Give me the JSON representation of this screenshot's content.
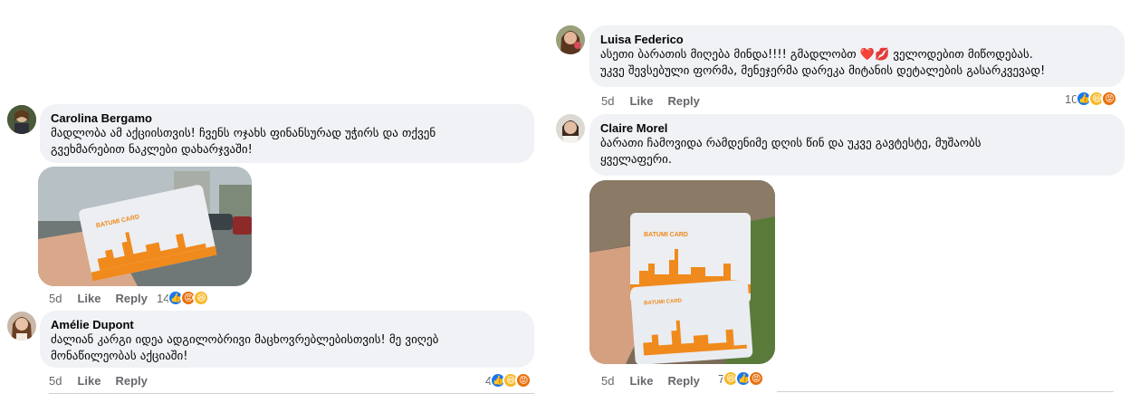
{
  "comments": {
    "carolina": {
      "name": "Carolina Bergamo",
      "lines": [
        "მადლობა ამ აქციისთვის! ჩვენს ოჯახს ფინანსურად უჭირს და თქვენ",
        "გვეხმარებით ნაკლები დახარჯვაში!"
      ],
      "time": "5d",
      "like": "Like",
      "reply": "Reply",
      "reactions": "14"
    },
    "amelie": {
      "name": "Amélie Dupont",
      "lines": [
        "ძალიან კარგი იდეა ადგილობრივი მაცხოვრებლებისთვის! მე ვიღებ",
        "მონაწილეობას აქციაში!"
      ],
      "time": "5d",
      "like": "Like",
      "reply": "Reply",
      "reactions": "4"
    },
    "luisa": {
      "name": "Luisa Federico",
      "lines": [
        "ასეთი ბარათის მიღება მინდა!!!! გმადლობთ ❤️💋 ველოდებით მიწოდებას.",
        "უკვე შევსებული ფორმა, მენეჯერმა დარეკა მიტანის დეტალების გასარკვევად!"
      ],
      "time": "5d",
      "like": "Like",
      "reply": "Reply",
      "reactions": "10"
    },
    "claire": {
      "name": "Claire Morel",
      "lines": [
        "ბარათი ჩამოვიდა რამდენიმე დღის წინ და უკვე გავტესტე, მუშაობს",
        "ყველაფერი."
      ],
      "time": "5d",
      "like": "Like",
      "reply": "Reply",
      "reactions": "7"
    }
  },
  "card_label": "BATUMI CARD",
  "colors": {
    "bubble": "#f0f2f5",
    "like": "#1877f2",
    "haha": "#f7b928",
    "angry": "#e9710f",
    "card_orange": "#f08a1c"
  },
  "icons": [
    "like-reaction-icon",
    "haha-reaction-icon",
    "angry-reaction-icon"
  ]
}
